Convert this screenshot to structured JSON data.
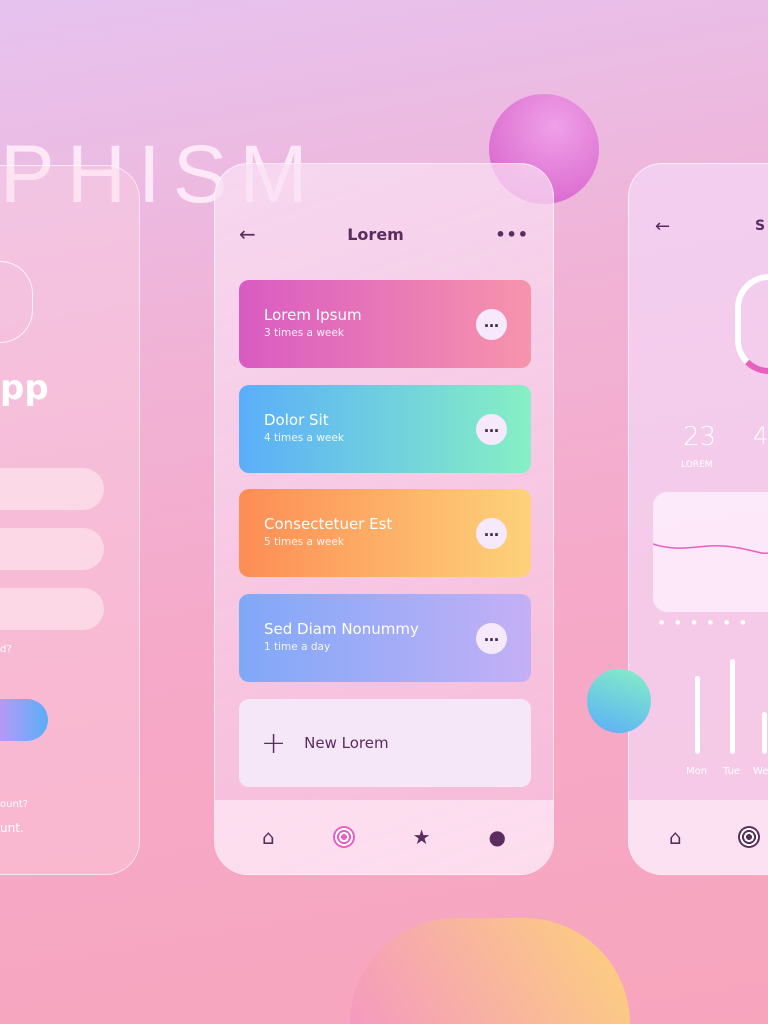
{
  "background_word": "PHISM",
  "left_screen": {
    "app_title_fragment": "pp",
    "forgot_fragment": "d?",
    "account_q_fragment": "ount?",
    "account_link_fragment": "unt."
  },
  "main_screen": {
    "title": "Lorem",
    "items": [
      {
        "name": "Lorem Ipsum",
        "freq": "3 times a week",
        "colors": [
          "#d95bc2",
          "#f794ac"
        ]
      },
      {
        "name": "Dolor Sit",
        "freq": "4 times a week",
        "colors": [
          "#5aaefa",
          "#86f0c4"
        ]
      },
      {
        "name": "Consectetuer Est",
        "freq": "5 times a week",
        "colors": [
          "#fd8d55",
          "#fdd27a"
        ]
      },
      {
        "name": "Sed Diam Nonummy",
        "freq": "1 time a day",
        "colors": [
          "#80a8f8",
          "#c4b0f6"
        ]
      }
    ],
    "new_label": "New Lorem",
    "nav": [
      "home-icon",
      "target-icon",
      "star-icon",
      "user-icon"
    ],
    "nav_active": 1
  },
  "stats_screen": {
    "title_fragment": "S",
    "stat1_value": "23",
    "stat1_label": "LOREM",
    "stat2_fragment": "4",
    "days": [
      "Mon",
      "Tue",
      "We"
    ],
    "bar_levels": [
      0.8,
      1.0,
      0.45
    ]
  },
  "colors": {
    "icon": "#5a2d5e",
    "accent": "#e85fbf"
  }
}
